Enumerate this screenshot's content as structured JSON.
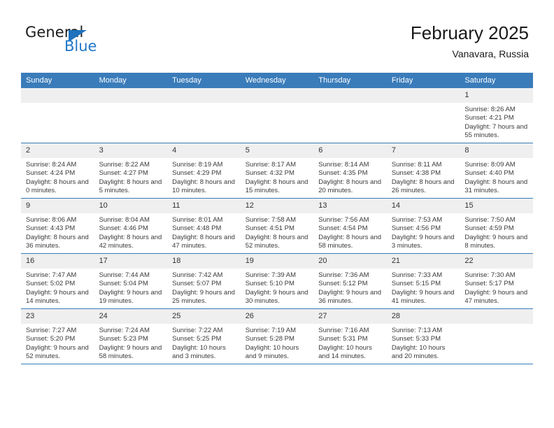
{
  "brand": {
    "word_general": "General",
    "word_blue": "Blue",
    "triangle_color": "#1f72bd"
  },
  "header": {
    "title": "February 2025",
    "subtitle": "Vanavara, Russia"
  },
  "theme": {
    "header_row_bg": "#3a7cba",
    "daynum_bg": "#efefef",
    "grid_line": "#3a7cba",
    "text": "#3a3a3a"
  },
  "weekday_headers": [
    "Sunday",
    "Monday",
    "Tuesday",
    "Wednesday",
    "Thursday",
    "Friday",
    "Saturday"
  ],
  "labels": {
    "sunrise_prefix": "Sunrise:",
    "sunset_prefix": "Sunset:",
    "daylight_prefix": "Daylight:"
  },
  "weeks": [
    [
      {
        "day": "",
        "sunrise": "",
        "sunset": "",
        "daylight": "",
        "empty": true
      },
      {
        "day": "",
        "sunrise": "",
        "sunset": "",
        "daylight": "",
        "empty": true
      },
      {
        "day": "",
        "sunrise": "",
        "sunset": "",
        "daylight": "",
        "empty": true
      },
      {
        "day": "",
        "sunrise": "",
        "sunset": "",
        "daylight": "",
        "empty": true
      },
      {
        "day": "",
        "sunrise": "",
        "sunset": "",
        "daylight": "",
        "empty": true
      },
      {
        "day": "",
        "sunrise": "",
        "sunset": "",
        "daylight": "",
        "empty": true
      },
      {
        "day": "1",
        "sunrise": "Sunrise: 8:26 AM",
        "sunset": "Sunset: 4:21 PM",
        "daylight": "Daylight: 7 hours and 55 minutes.",
        "empty": false
      }
    ],
    [
      {
        "day": "2",
        "sunrise": "Sunrise: 8:24 AM",
        "sunset": "Sunset: 4:24 PM",
        "daylight": "Daylight: 8 hours and 0 minutes.",
        "empty": false
      },
      {
        "day": "3",
        "sunrise": "Sunrise: 8:22 AM",
        "sunset": "Sunset: 4:27 PM",
        "daylight": "Daylight: 8 hours and 5 minutes.",
        "empty": false
      },
      {
        "day": "4",
        "sunrise": "Sunrise: 8:19 AM",
        "sunset": "Sunset: 4:29 PM",
        "daylight": "Daylight: 8 hours and 10 minutes.",
        "empty": false
      },
      {
        "day": "5",
        "sunrise": "Sunrise: 8:17 AM",
        "sunset": "Sunset: 4:32 PM",
        "daylight": "Daylight: 8 hours and 15 minutes.",
        "empty": false
      },
      {
        "day": "6",
        "sunrise": "Sunrise: 8:14 AM",
        "sunset": "Sunset: 4:35 PM",
        "daylight": "Daylight: 8 hours and 20 minutes.",
        "empty": false
      },
      {
        "day": "7",
        "sunrise": "Sunrise: 8:11 AM",
        "sunset": "Sunset: 4:38 PM",
        "daylight": "Daylight: 8 hours and 26 minutes.",
        "empty": false
      },
      {
        "day": "8",
        "sunrise": "Sunrise: 8:09 AM",
        "sunset": "Sunset: 4:40 PM",
        "daylight": "Daylight: 8 hours and 31 minutes.",
        "empty": false
      }
    ],
    [
      {
        "day": "9",
        "sunrise": "Sunrise: 8:06 AM",
        "sunset": "Sunset: 4:43 PM",
        "daylight": "Daylight: 8 hours and 36 minutes.",
        "empty": false
      },
      {
        "day": "10",
        "sunrise": "Sunrise: 8:04 AM",
        "sunset": "Sunset: 4:46 PM",
        "daylight": "Daylight: 8 hours and 42 minutes.",
        "empty": false
      },
      {
        "day": "11",
        "sunrise": "Sunrise: 8:01 AM",
        "sunset": "Sunset: 4:48 PM",
        "daylight": "Daylight: 8 hours and 47 minutes.",
        "empty": false
      },
      {
        "day": "12",
        "sunrise": "Sunrise: 7:58 AM",
        "sunset": "Sunset: 4:51 PM",
        "daylight": "Daylight: 8 hours and 52 minutes.",
        "empty": false
      },
      {
        "day": "13",
        "sunrise": "Sunrise: 7:56 AM",
        "sunset": "Sunset: 4:54 PM",
        "daylight": "Daylight: 8 hours and 58 minutes.",
        "empty": false
      },
      {
        "day": "14",
        "sunrise": "Sunrise: 7:53 AM",
        "sunset": "Sunset: 4:56 PM",
        "daylight": "Daylight: 9 hours and 3 minutes.",
        "empty": false
      },
      {
        "day": "15",
        "sunrise": "Sunrise: 7:50 AM",
        "sunset": "Sunset: 4:59 PM",
        "daylight": "Daylight: 9 hours and 8 minutes.",
        "empty": false
      }
    ],
    [
      {
        "day": "16",
        "sunrise": "Sunrise: 7:47 AM",
        "sunset": "Sunset: 5:02 PM",
        "daylight": "Daylight: 9 hours and 14 minutes.",
        "empty": false
      },
      {
        "day": "17",
        "sunrise": "Sunrise: 7:44 AM",
        "sunset": "Sunset: 5:04 PM",
        "daylight": "Daylight: 9 hours and 19 minutes.",
        "empty": false
      },
      {
        "day": "18",
        "sunrise": "Sunrise: 7:42 AM",
        "sunset": "Sunset: 5:07 PM",
        "daylight": "Daylight: 9 hours and 25 minutes.",
        "empty": false
      },
      {
        "day": "19",
        "sunrise": "Sunrise: 7:39 AM",
        "sunset": "Sunset: 5:10 PM",
        "daylight": "Daylight: 9 hours and 30 minutes.",
        "empty": false
      },
      {
        "day": "20",
        "sunrise": "Sunrise: 7:36 AM",
        "sunset": "Sunset: 5:12 PM",
        "daylight": "Daylight: 9 hours and 36 minutes.",
        "empty": false
      },
      {
        "day": "21",
        "sunrise": "Sunrise: 7:33 AM",
        "sunset": "Sunset: 5:15 PM",
        "daylight": "Daylight: 9 hours and 41 minutes.",
        "empty": false
      },
      {
        "day": "22",
        "sunrise": "Sunrise: 7:30 AM",
        "sunset": "Sunset: 5:17 PM",
        "daylight": "Daylight: 9 hours and 47 minutes.",
        "empty": false
      }
    ],
    [
      {
        "day": "23",
        "sunrise": "Sunrise: 7:27 AM",
        "sunset": "Sunset: 5:20 PM",
        "daylight": "Daylight: 9 hours and 52 minutes.",
        "empty": false
      },
      {
        "day": "24",
        "sunrise": "Sunrise: 7:24 AM",
        "sunset": "Sunset: 5:23 PM",
        "daylight": "Daylight: 9 hours and 58 minutes.",
        "empty": false
      },
      {
        "day": "25",
        "sunrise": "Sunrise: 7:22 AM",
        "sunset": "Sunset: 5:25 PM",
        "daylight": "Daylight: 10 hours and 3 minutes.",
        "empty": false
      },
      {
        "day": "26",
        "sunrise": "Sunrise: 7:19 AM",
        "sunset": "Sunset: 5:28 PM",
        "daylight": "Daylight: 10 hours and 9 minutes.",
        "empty": false
      },
      {
        "day": "27",
        "sunrise": "Sunrise: 7:16 AM",
        "sunset": "Sunset: 5:31 PM",
        "daylight": "Daylight: 10 hours and 14 minutes.",
        "empty": false
      },
      {
        "day": "28",
        "sunrise": "Sunrise: 7:13 AM",
        "sunset": "Sunset: 5:33 PM",
        "daylight": "Daylight: 10 hours and 20 minutes.",
        "empty": false
      },
      {
        "day": "",
        "sunrise": "",
        "sunset": "",
        "daylight": "",
        "empty": true
      }
    ]
  ]
}
